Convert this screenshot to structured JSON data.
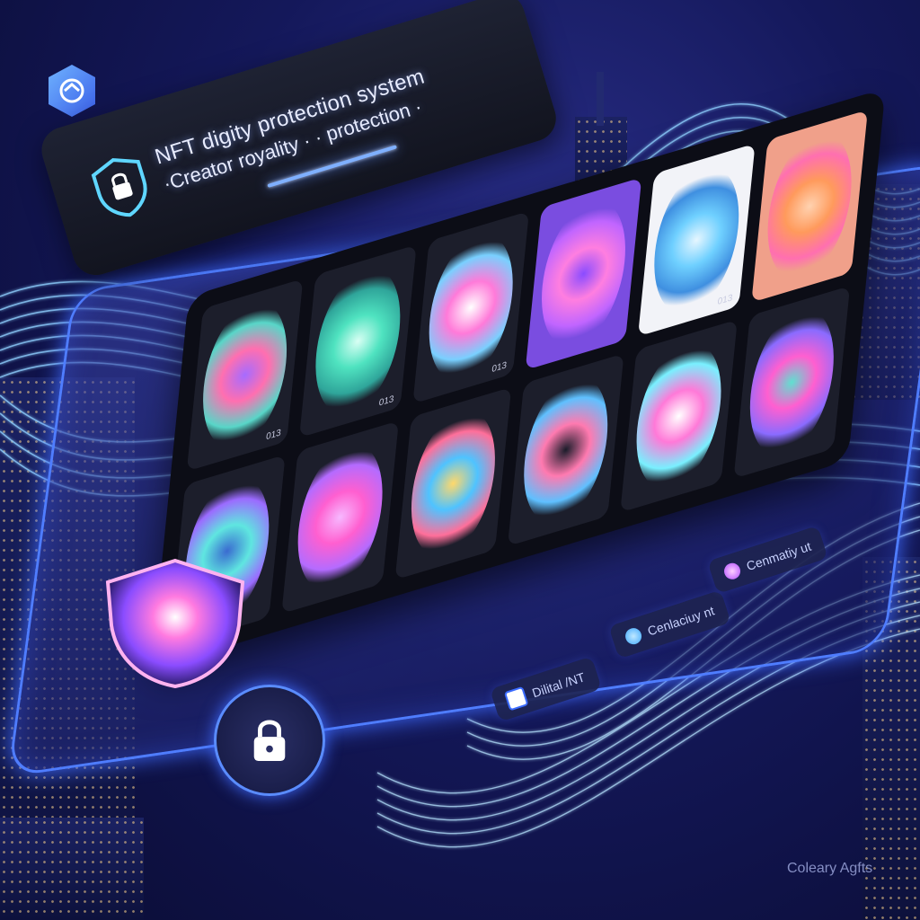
{
  "banner": {
    "title": "NFT digity protection system",
    "subtitle": "·Creator royality · · protection ·"
  },
  "gallery": {
    "cards": [
      {
        "tag": "013",
        "palette": [
          "#ff6fb0",
          "#58d6c8",
          "#a66bff"
        ]
      },
      {
        "tag": "013",
        "palette": [
          "#4fe3c0",
          "#2fa59a",
          "#d9fff4"
        ]
      },
      {
        "tag": "013",
        "palette": [
          "#ff7ad9",
          "#79d0ff",
          "#ffffff"
        ]
      },
      {
        "tag": "",
        "palette": [
          "#ff7ee0",
          "#c065ff",
          "#8a4cff"
        ]
      },
      {
        "tag": "013",
        "palette": [
          "#6fd0ff",
          "#3f8fe0",
          "#e6f6ff"
        ]
      },
      {
        "tag": "",
        "palette": [
          "#ff9a5c",
          "#ff6fb0",
          "#ffd2b0"
        ]
      },
      {
        "tag": "",
        "palette": [
          "#5fe6e0",
          "#9b6bff",
          "#3a6bd0"
        ]
      },
      {
        "tag": "",
        "palette": [
          "#ff5fd0",
          "#b46bff",
          "#f7b8ff"
        ]
      },
      {
        "tag": "",
        "palette": [
          "#4fc3ff",
          "#ff6f9a",
          "#ffd86b"
        ]
      },
      {
        "tag": "",
        "palette": [
          "#ff7ab0",
          "#5fc0ff",
          "#1a1c2a"
        ]
      },
      {
        "tag": "",
        "palette": [
          "#ff79d8",
          "#79f0ff",
          "#ffffff"
        ]
      },
      {
        "tag": "",
        "palette": [
          "#ff5fd0",
          "#8a6bff",
          "#5fe0d0"
        ]
      }
    ]
  },
  "pills": [
    {
      "label": "Dilital /NT",
      "icon": "grid-icon"
    },
    {
      "label": "Cenlaciuy nt",
      "icon": "flower-icon"
    },
    {
      "label": "Cenmatiy ut",
      "icon": "flower-icon"
    }
  ],
  "watermark": "Coleary Agfts",
  "colors": {
    "accent": "#4f7dff",
    "glow": "#7fb0ff",
    "background": "#14185a"
  }
}
